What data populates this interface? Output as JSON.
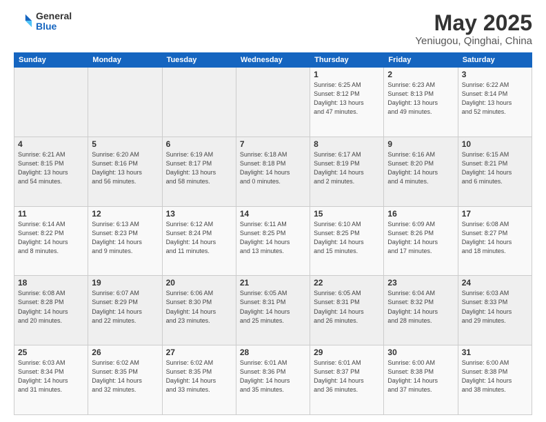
{
  "header": {
    "logo_general": "General",
    "logo_blue": "Blue",
    "title": "May 2025",
    "subtitle": "Yeniugou, Qinghai, China"
  },
  "calendar": {
    "headers": [
      "Sunday",
      "Monday",
      "Tuesday",
      "Wednesday",
      "Thursday",
      "Friday",
      "Saturday"
    ],
    "weeks": [
      [
        {
          "day": "",
          "info": ""
        },
        {
          "day": "",
          "info": ""
        },
        {
          "day": "",
          "info": ""
        },
        {
          "day": "",
          "info": ""
        },
        {
          "day": "1",
          "info": "Sunrise: 6:25 AM\nSunset: 8:12 PM\nDaylight: 13 hours\nand 47 minutes."
        },
        {
          "day": "2",
          "info": "Sunrise: 6:23 AM\nSunset: 8:13 PM\nDaylight: 13 hours\nand 49 minutes."
        },
        {
          "day": "3",
          "info": "Sunrise: 6:22 AM\nSunset: 8:14 PM\nDaylight: 13 hours\nand 52 minutes."
        }
      ],
      [
        {
          "day": "4",
          "info": "Sunrise: 6:21 AM\nSunset: 8:15 PM\nDaylight: 13 hours\nand 54 minutes."
        },
        {
          "day": "5",
          "info": "Sunrise: 6:20 AM\nSunset: 8:16 PM\nDaylight: 13 hours\nand 56 minutes."
        },
        {
          "day": "6",
          "info": "Sunrise: 6:19 AM\nSunset: 8:17 PM\nDaylight: 13 hours\nand 58 minutes."
        },
        {
          "day": "7",
          "info": "Sunrise: 6:18 AM\nSunset: 8:18 PM\nDaylight: 14 hours\nand 0 minutes."
        },
        {
          "day": "8",
          "info": "Sunrise: 6:17 AM\nSunset: 8:19 PM\nDaylight: 14 hours\nand 2 minutes."
        },
        {
          "day": "9",
          "info": "Sunrise: 6:16 AM\nSunset: 8:20 PM\nDaylight: 14 hours\nand 4 minutes."
        },
        {
          "day": "10",
          "info": "Sunrise: 6:15 AM\nSunset: 8:21 PM\nDaylight: 14 hours\nand 6 minutes."
        }
      ],
      [
        {
          "day": "11",
          "info": "Sunrise: 6:14 AM\nSunset: 8:22 PM\nDaylight: 14 hours\nand 8 minutes."
        },
        {
          "day": "12",
          "info": "Sunrise: 6:13 AM\nSunset: 8:23 PM\nDaylight: 14 hours\nand 9 minutes."
        },
        {
          "day": "13",
          "info": "Sunrise: 6:12 AM\nSunset: 8:24 PM\nDaylight: 14 hours\nand 11 minutes."
        },
        {
          "day": "14",
          "info": "Sunrise: 6:11 AM\nSunset: 8:25 PM\nDaylight: 14 hours\nand 13 minutes."
        },
        {
          "day": "15",
          "info": "Sunrise: 6:10 AM\nSunset: 8:25 PM\nDaylight: 14 hours\nand 15 minutes."
        },
        {
          "day": "16",
          "info": "Sunrise: 6:09 AM\nSunset: 8:26 PM\nDaylight: 14 hours\nand 17 minutes."
        },
        {
          "day": "17",
          "info": "Sunrise: 6:08 AM\nSunset: 8:27 PM\nDaylight: 14 hours\nand 18 minutes."
        }
      ],
      [
        {
          "day": "18",
          "info": "Sunrise: 6:08 AM\nSunset: 8:28 PM\nDaylight: 14 hours\nand 20 minutes."
        },
        {
          "day": "19",
          "info": "Sunrise: 6:07 AM\nSunset: 8:29 PM\nDaylight: 14 hours\nand 22 minutes."
        },
        {
          "day": "20",
          "info": "Sunrise: 6:06 AM\nSunset: 8:30 PM\nDaylight: 14 hours\nand 23 minutes."
        },
        {
          "day": "21",
          "info": "Sunrise: 6:05 AM\nSunset: 8:31 PM\nDaylight: 14 hours\nand 25 minutes."
        },
        {
          "day": "22",
          "info": "Sunrise: 6:05 AM\nSunset: 8:31 PM\nDaylight: 14 hours\nand 26 minutes."
        },
        {
          "day": "23",
          "info": "Sunrise: 6:04 AM\nSunset: 8:32 PM\nDaylight: 14 hours\nand 28 minutes."
        },
        {
          "day": "24",
          "info": "Sunrise: 6:03 AM\nSunset: 8:33 PM\nDaylight: 14 hours\nand 29 minutes."
        }
      ],
      [
        {
          "day": "25",
          "info": "Sunrise: 6:03 AM\nSunset: 8:34 PM\nDaylight: 14 hours\nand 31 minutes."
        },
        {
          "day": "26",
          "info": "Sunrise: 6:02 AM\nSunset: 8:35 PM\nDaylight: 14 hours\nand 32 minutes."
        },
        {
          "day": "27",
          "info": "Sunrise: 6:02 AM\nSunset: 8:35 PM\nDaylight: 14 hours\nand 33 minutes."
        },
        {
          "day": "28",
          "info": "Sunrise: 6:01 AM\nSunset: 8:36 PM\nDaylight: 14 hours\nand 35 minutes."
        },
        {
          "day": "29",
          "info": "Sunrise: 6:01 AM\nSunset: 8:37 PM\nDaylight: 14 hours\nand 36 minutes."
        },
        {
          "day": "30",
          "info": "Sunrise: 6:00 AM\nSunset: 8:38 PM\nDaylight: 14 hours\nand 37 minutes."
        },
        {
          "day": "31",
          "info": "Sunrise: 6:00 AM\nSunset: 8:38 PM\nDaylight: 14 hours\nand 38 minutes."
        }
      ]
    ]
  }
}
